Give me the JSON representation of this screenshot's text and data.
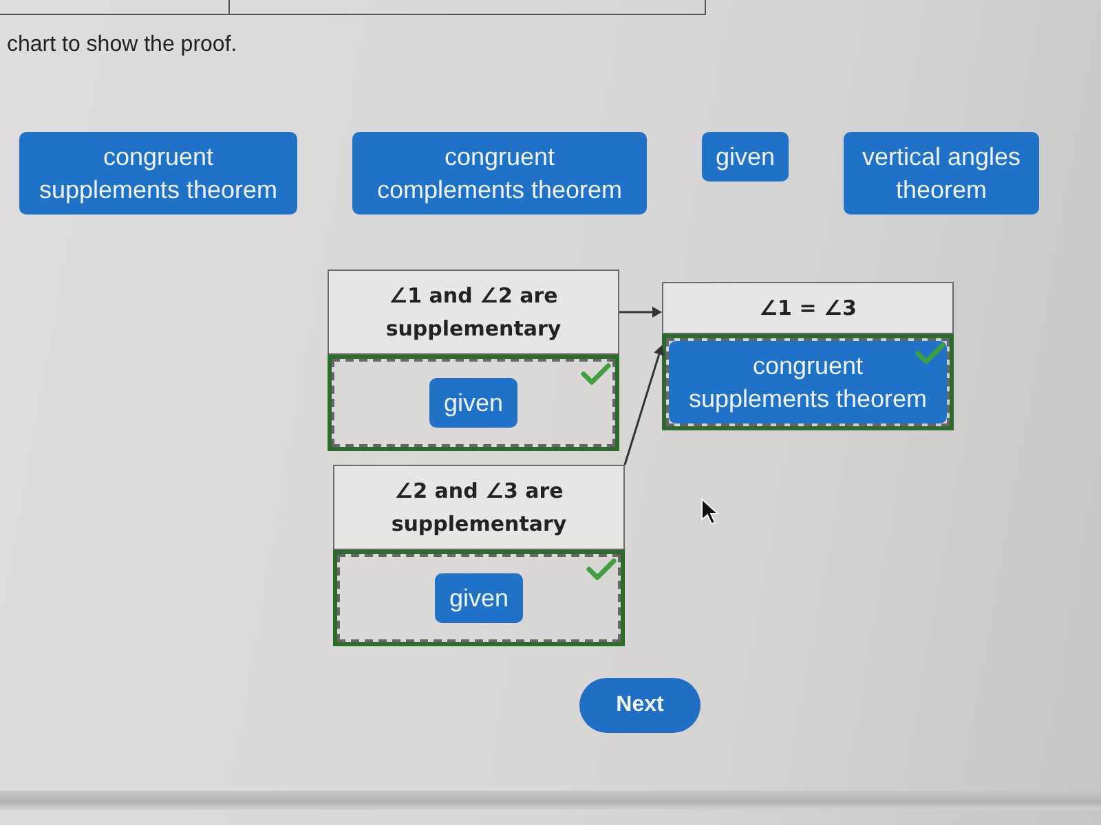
{
  "instruction": "chart to show the proof.",
  "answer_bank": [
    "congruent supplements theorem",
    "congruent complements theorem",
    "given",
    "vertical angles theorem"
  ],
  "proof_chart": [
    {
      "statement": "∠1 and ∠2 are supplementary",
      "reason": "given",
      "correct": true
    },
    {
      "statement": "∠1 = ∠3",
      "reason": "congruent supplements theorem",
      "correct": true
    },
    {
      "statement": "∠2 and ∠3 are supplementary",
      "reason": "given",
      "correct": true
    }
  ],
  "next_button": "Next"
}
